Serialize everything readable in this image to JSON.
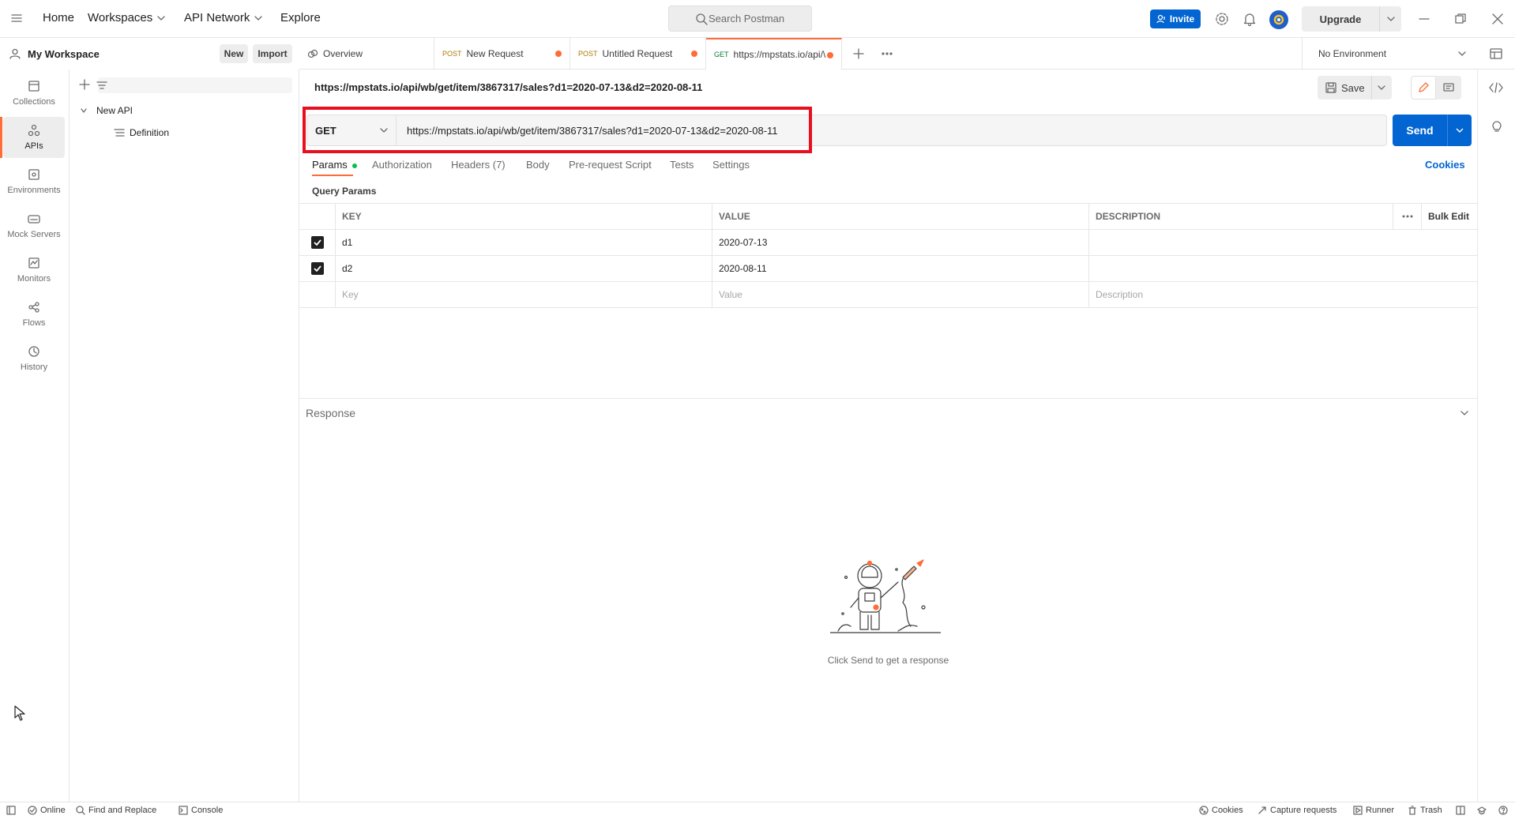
{
  "topbar": {
    "nav": {
      "home": "Home",
      "workspaces": "Workspaces",
      "api_network": "API Network",
      "explore": "Explore"
    },
    "search_placeholder": "Search Postman",
    "invite": "Invite",
    "upgrade": "Upgrade"
  },
  "workspace": {
    "name": "My Workspace",
    "new": "New",
    "import": "Import"
  },
  "rail": [
    {
      "label": "Collections",
      "icon": "collections-icon"
    },
    {
      "label": "APIs",
      "icon": "apis-icon",
      "active": true
    },
    {
      "label": "Environments",
      "icon": "environments-icon"
    },
    {
      "label": "Mock Servers",
      "icon": "mock-servers-icon"
    },
    {
      "label": "Monitors",
      "icon": "monitors-icon"
    },
    {
      "label": "Flows",
      "icon": "flows-icon"
    },
    {
      "label": "History",
      "icon": "history-icon"
    }
  ],
  "tree": {
    "api_name": "New API",
    "definition": "Definition"
  },
  "tabs": [
    {
      "method": "",
      "label": "Overview"
    },
    {
      "method": "POST",
      "label": "New Request"
    },
    {
      "method": "POST",
      "label": "Untitled Request"
    },
    {
      "method": "GET",
      "label": "https://mpstats.io/api/\\"
    }
  ],
  "environment": "No Environment",
  "request": {
    "title": "https://mpstats.io/api/wb/get/item/3867317/sales?d1=2020-07-13&d2=2020-08-11",
    "save": "Save",
    "method": "GET",
    "url": "https://mpstats.io/api/wb/get/item/3867317/sales?d1=2020-07-13&d2=2020-08-11",
    "send": "Send",
    "subtabs": {
      "params": "Params",
      "authorization": "Authorization",
      "headers": "Headers (7)",
      "body": "Body",
      "prerequest": "Pre-request Script",
      "tests": "Tests",
      "settings": "Settings"
    },
    "cookies": "Cookies",
    "query_params_label": "Query Params",
    "columns": {
      "key": "KEY",
      "value": "VALUE",
      "description": "DESCRIPTION",
      "bulk_edit": "Bulk Edit"
    },
    "params": [
      {
        "key": "d1",
        "value": "2020-07-13",
        "description": ""
      },
      {
        "key": "d2",
        "value": "2020-08-11",
        "description": ""
      }
    ],
    "placeholders": {
      "key": "Key",
      "value": "Value",
      "description": "Description"
    }
  },
  "response": {
    "label": "Response",
    "hint": "Click Send to get a response"
  },
  "statusbar": {
    "online": "Online",
    "find_replace": "Find and Replace",
    "console": "Console",
    "cookies": "Cookies",
    "capture": "Capture requests",
    "runner": "Runner",
    "trash": "Trash"
  },
  "colors": {
    "accent": "#ff6c37",
    "primary": "#0265d2",
    "highlight": "#e8101e"
  }
}
